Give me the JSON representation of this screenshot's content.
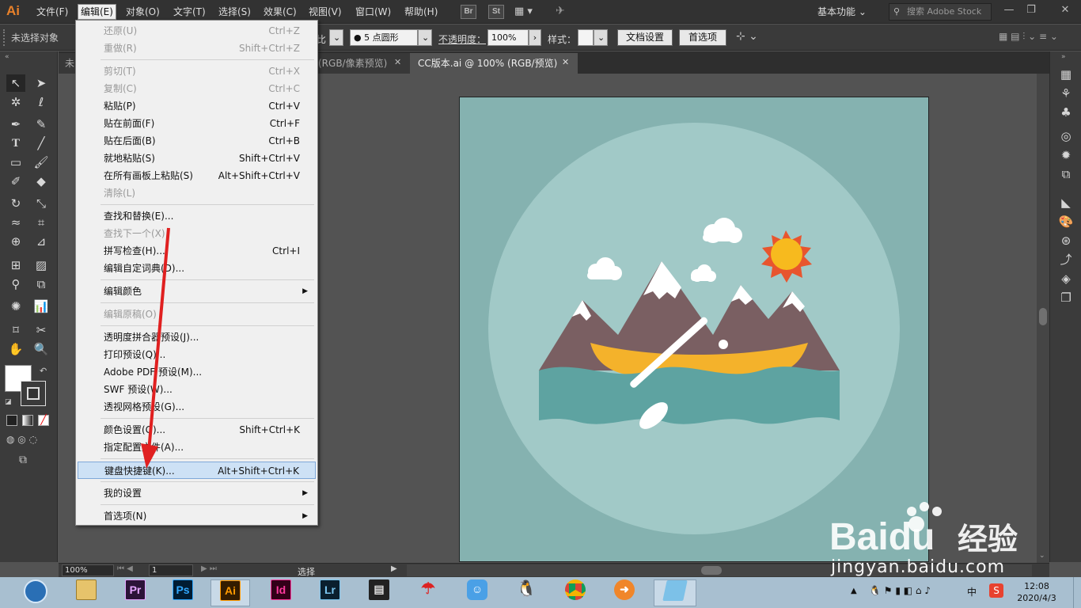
{
  "app": {
    "logo": "Ai",
    "menus": [
      "文件(F)",
      "编辑(E)",
      "对象(O)",
      "文字(T)",
      "选择(S)",
      "效果(C)",
      "视图(V)",
      "窗口(W)",
      "帮助(H)"
    ],
    "bridge": "Br",
    "stock": "St",
    "workspace": "基本功能",
    "stock_search_placeholder": "搜索 Adobe Stock"
  },
  "control_bar": {
    "selection_text": "未选择对象",
    "ratio_label": "比",
    "brush": "5 点圆形",
    "opacity_label": "不透明度：",
    "opacity_value": "100%",
    "style_label": "样式：",
    "doc_settings": "文档设置",
    "preferences": "首选项"
  },
  "tabs": [
    {
      "label": "未",
      "active": false
    },
    {
      "label": "(RGB/像素预览)",
      "active": false
    },
    {
      "label": "CC版本.ai @ 100% (RGB/预览)",
      "active": true
    }
  ],
  "edit_menu": {
    "items": [
      {
        "label": "还原(U)",
        "shortcut": "Ctrl+Z",
        "disabled": true
      },
      {
        "label": "重做(R)",
        "shortcut": "Shift+Ctrl+Z",
        "disabled": true
      },
      {
        "label": "剪切(T)",
        "shortcut": "Ctrl+X",
        "disabled": true
      },
      {
        "label": "复制(C)",
        "shortcut": "Ctrl+C",
        "disabled": true
      },
      {
        "label": "粘贴(P)",
        "shortcut": "Ctrl+V",
        "disabled": false
      },
      {
        "label": "贴在前面(F)",
        "shortcut": "Ctrl+F",
        "disabled": false
      },
      {
        "label": "贴在后面(B)",
        "shortcut": "Ctrl+B",
        "disabled": false
      },
      {
        "label": "就地粘贴(S)",
        "shortcut": "Shift+Ctrl+V",
        "disabled": false
      },
      {
        "label": "在所有画板上粘贴(S)",
        "shortcut": "Alt+Shift+Ctrl+V",
        "disabled": false
      },
      {
        "label": "清除(L)",
        "shortcut": "",
        "disabled": true
      },
      {
        "label": "查找和替换(E)...",
        "shortcut": "",
        "disabled": false
      },
      {
        "label": "查找下一个(X)",
        "shortcut": "",
        "disabled": true
      },
      {
        "label": "拼写检查(H)...",
        "shortcut": "Ctrl+I",
        "disabled": false
      },
      {
        "label": "编辑自定词典(D)...",
        "shortcut": "",
        "disabled": false
      },
      {
        "label": "编辑颜色",
        "shortcut": "",
        "disabled": false,
        "submenu": true
      },
      {
        "label": "编辑原稿(O)",
        "shortcut": "",
        "disabled": true
      },
      {
        "label": "透明度拼合器预设(J)...",
        "shortcut": "",
        "disabled": false
      },
      {
        "label": "打印预设(Q)...",
        "shortcut": "",
        "disabled": false
      },
      {
        "label": "Adobe PDF 预设(M)...",
        "shortcut": "",
        "disabled": false
      },
      {
        "label": "SWF 预设(W)...",
        "shortcut": "",
        "disabled": false
      },
      {
        "label": "透视网格预设(G)...",
        "shortcut": "",
        "disabled": false
      },
      {
        "label": "颜色设置(G)...",
        "shortcut": "Shift+Ctrl+K",
        "disabled": false
      },
      {
        "label": "指定配置文件(A)...",
        "shortcut": "",
        "disabled": false
      },
      {
        "label": "键盘快捷键(K)...",
        "shortcut": "Alt+Shift+Ctrl+K",
        "disabled": false,
        "highlighted": true
      },
      {
        "label": "我的设置",
        "shortcut": "",
        "disabled": false,
        "submenu": true
      },
      {
        "label": "首选项(N)",
        "shortcut": "",
        "disabled": false,
        "submenu": true
      }
    ]
  },
  "status_bar": {
    "zoom": "100%",
    "page": "1",
    "tool_label": "选择"
  },
  "taskbar": {
    "apps": [
      "Pr",
      "Ps",
      "Ai",
      "Id",
      "Lr"
    ],
    "time": "12:08",
    "date": "2020/4/3",
    "ime": "中"
  },
  "watermark": {
    "brand": "Baidu",
    "text": "经验",
    "url": "jingyan.baidu.com"
  },
  "colors": {
    "artboard_bg": "#85b2b0",
    "circle": "#a1c9c7",
    "mountain": "#7a5f62",
    "snow": "#ffffff",
    "boat": "#f4b22b",
    "water": "#5ea3a1",
    "sun": "#f7ba1e",
    "sun_rays": "#e8552e",
    "arrow": "#e02020",
    "menu_highlight": "#cde1f5"
  }
}
